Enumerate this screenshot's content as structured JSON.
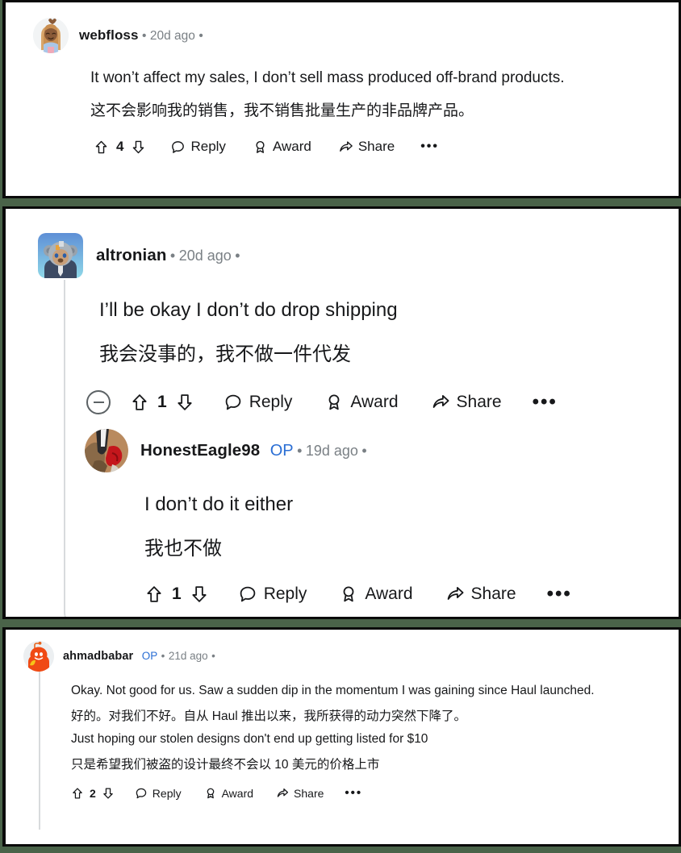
{
  "theme": {
    "background": "#4a6349",
    "panel_bg": "#ffffff",
    "panel_border": "#0a0a0a",
    "text": "#17181a",
    "meta_text": "#7a8085",
    "op_badge": "#2a6ed4",
    "thread_line": "#d8dbdd"
  },
  "comments": [
    {
      "id": "comment-webfloss",
      "username": "webfloss",
      "avatar": "girl-avatar",
      "op": false,
      "timestamp": "20d ago",
      "separator": "•",
      "lines": [
        "It won’t affect my sales, I don’t sell mass produced off-brand products.",
        "这不会影响我的销售，我不销售批量生产的非品牌产品。"
      ],
      "actions": {
        "upvote_icon": "upvote-arrow-icon",
        "vote_count": "4",
        "downvote_icon": "downvote-arrow-icon",
        "reply_icon": "comment-bubble-icon",
        "reply_label": "Reply",
        "award_icon": "award-ribbon-icon",
        "award_label": "Award",
        "share_icon": "share-arrow-icon",
        "share_label": "Share",
        "more_label": "•••"
      }
    },
    {
      "id": "comment-altronian",
      "username": "altronian",
      "avatar": "koala-avatar",
      "op": false,
      "timestamp": "20d ago",
      "separator": "•",
      "collapse_icon": "collapse-minus-icon",
      "lines": [
        "I’ll be okay I don’t do drop shipping",
        "我会没事的，我不做一件代发"
      ],
      "actions": {
        "upvote_icon": "upvote-arrow-icon",
        "vote_count": "1",
        "downvote_icon": "downvote-arrow-icon",
        "reply_icon": "comment-bubble-icon",
        "reply_label": "Reply",
        "award_icon": "award-ribbon-icon",
        "award_label": "Award",
        "share_icon": "share-arrow-icon",
        "share_label": "Share",
        "more_label": "•••"
      },
      "reply": {
        "id": "comment-honesteagle98",
        "username": "HonestEagle98",
        "avatar": "photo-avatar",
        "op": true,
        "op_label": "OP",
        "timestamp": "19d ago",
        "separator": "•",
        "lines": [
          "I don’t do it either",
          "我也不做"
        ],
        "actions": {
          "upvote_icon": "upvote-arrow-icon",
          "vote_count": "1",
          "downvote_icon": "downvote-arrow-icon",
          "reply_icon": "comment-bubble-icon",
          "reply_label": "Reply",
          "award_icon": "award-ribbon-icon",
          "award_label": "Award",
          "share_icon": "share-arrow-icon",
          "share_label": "Share",
          "more_label": "•••"
        }
      }
    },
    {
      "id": "comment-ahmadbabar",
      "username": "ahmadbabar",
      "avatar": "snoo-avatar",
      "op": true,
      "op_label": "OP",
      "timestamp": "21d ago",
      "separator": "•",
      "lines": [
        "Okay. Not good for us. Saw a sudden dip in the momentum I was gaining since Haul launched.",
        "好的。对我们不好。自从 Haul 推出以来，我所获得的动力突然下降了。",
        "Just hoping our stolen designs don't end up getting listed for $10",
        "只是希望我们被盗的设计最终不会以 10 美元的价格上市"
      ],
      "actions": {
        "upvote_icon": "upvote-arrow-icon",
        "vote_count": "2",
        "downvote_icon": "downvote-arrow-icon",
        "reply_icon": "comment-bubble-icon",
        "reply_label": "Reply",
        "award_icon": "award-ribbon-icon",
        "award_label": "Award",
        "share_icon": "share-arrow-icon",
        "share_label": "Share",
        "more_label": "•••"
      }
    }
  ]
}
